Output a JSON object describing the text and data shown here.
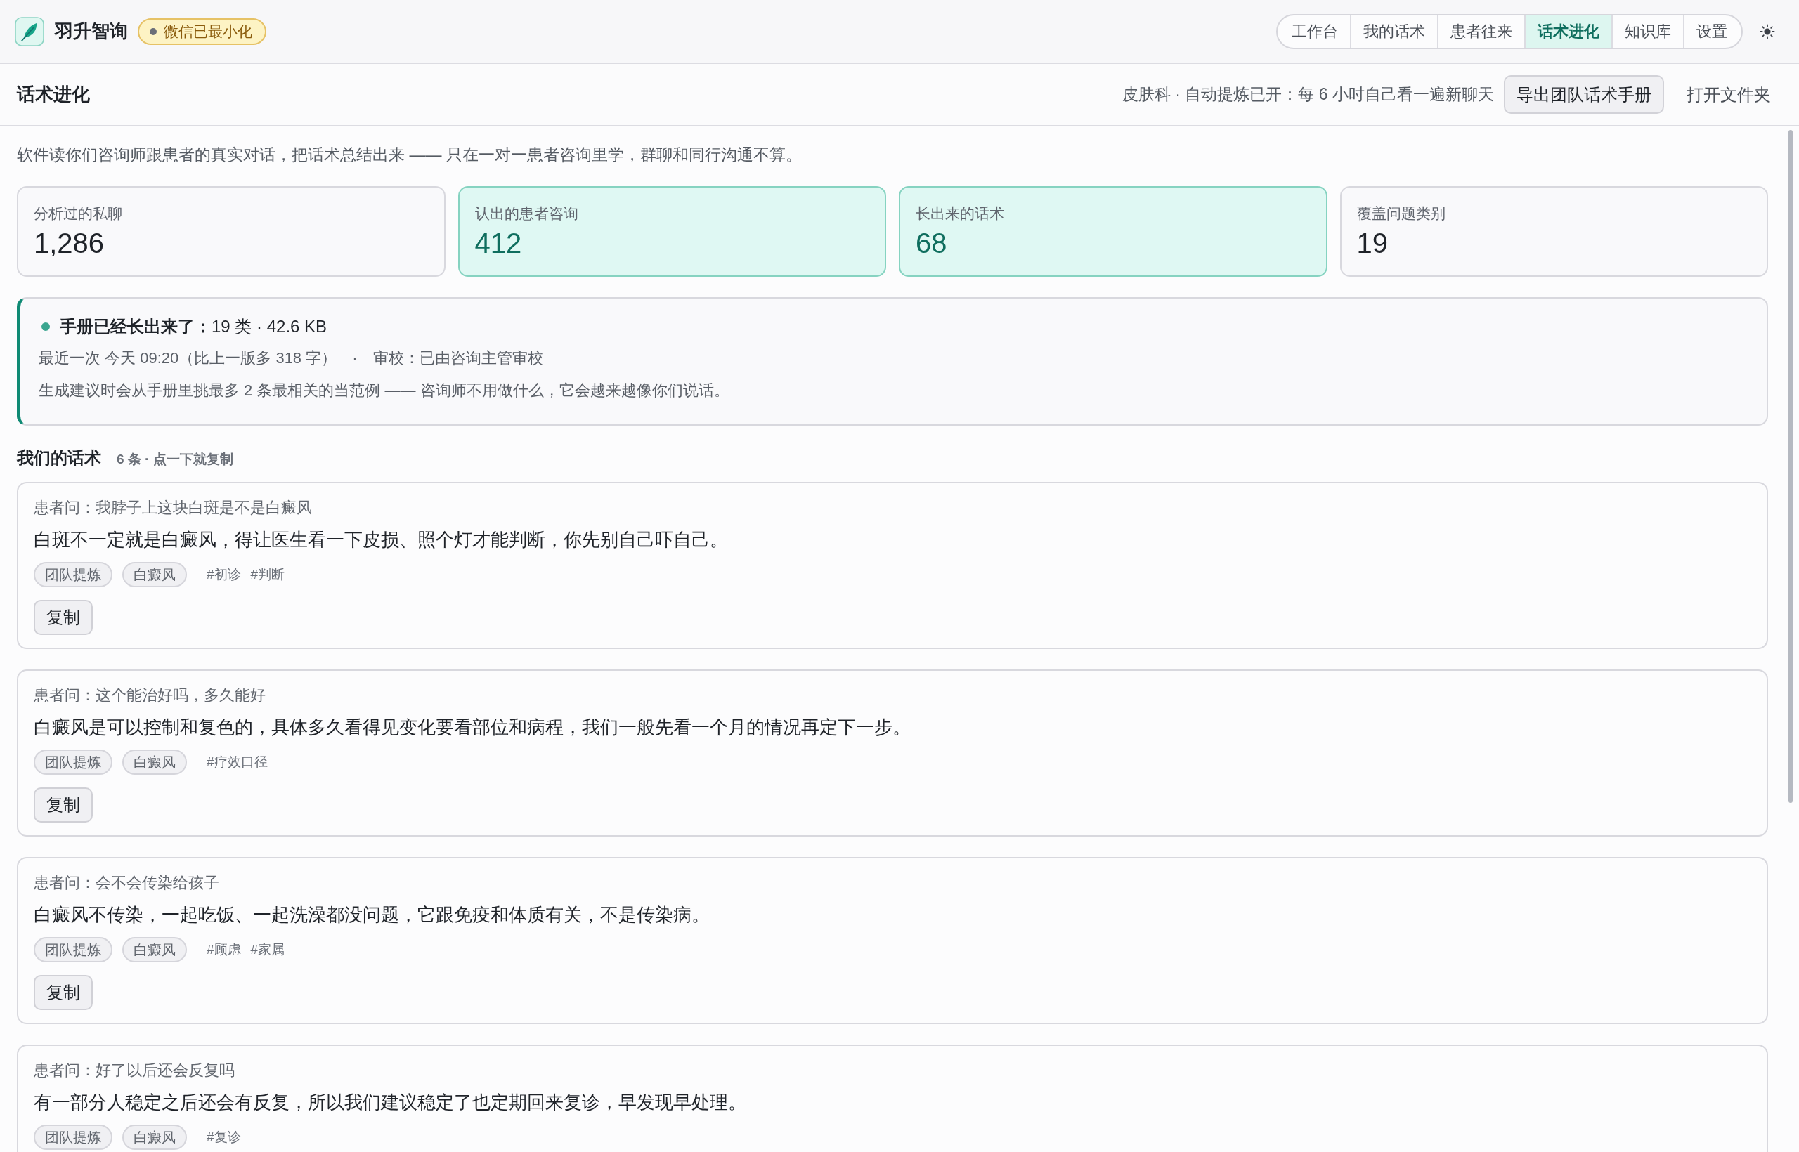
{
  "header": {
    "app_title": "羽升智询",
    "status_badge": "微信已最小化",
    "nav_tabs": [
      {
        "label": "工作台",
        "selected": false
      },
      {
        "label": "我的话术",
        "selected": false
      },
      {
        "label": "患者往来",
        "selected": false
      },
      {
        "label": "话术进化",
        "selected": true
      },
      {
        "label": "知识库",
        "selected": false
      },
      {
        "label": "设置",
        "selected": false
      }
    ]
  },
  "page_bar": {
    "title": "话术进化",
    "status": "皮肤科 · 自动提炼已开：每 6 小时自己看一遍新聊天",
    "buttons": [
      {
        "label": "导出团队话术手册",
        "kind": "outlined"
      },
      {
        "label": "打开文件夹",
        "kind": "plain"
      }
    ]
  },
  "intro": "软件读你们咨询师跟患者的真实对话，把话术总结出来 —— 只在一对一患者咨询里学，群聊和同行沟通不算。",
  "stats": [
    {
      "label": "分析过的私聊",
      "value": "1,286",
      "highlighted": false
    },
    {
      "label": "认出的患者咨询",
      "value": "412",
      "highlighted": true
    },
    {
      "label": "长出来的话术",
      "value": "68",
      "highlighted": true
    },
    {
      "label": "覆盖问题类别",
      "value": "19",
      "highlighted": false
    }
  ],
  "manual_panel": {
    "title": "**手册已经长出来了：**19 类 · 42.6 KB",
    "meta": [
      "最近一次 今天 09:20（比上一版多 318 字）",
      "·",
      "审校：已由咨询主管审校"
    ],
    "note": "生成建议时会从手册里挑最多 2 条最相关的当范例 —— 咨询师不用做什么，它会越来越像你们说话。"
  },
  "scripts": {
    "title": "我们的话术",
    "count": "6 条 · 点一下就复制",
    "items": [
      {
        "question": "患者问：我脖子上这块白斑是不是白癜风",
        "answer": "白斑不一定就是白癜风，得让医生看一下皮损、照个灯才能判断，你先别自己吓自己。",
        "tags": [
          "团队提炼",
          "白癜风"
        ],
        "hashtags": [
          "#初诊",
          "#判断"
        ],
        "copy_button": "复制"
      },
      {
        "question": "患者问：这个能治好吗，多久能好",
        "answer": "白癜风是可以控制和复色的，具体多久看得见变化要看部位和病程，我们一般先看一个月的情况再定下一步。",
        "tags": [
          "团队提炼",
          "白癜风"
        ],
        "hashtags": [
          "#疗效口径"
        ],
        "copy_button": "复制"
      },
      {
        "question": "患者问：会不会传染给孩子",
        "answer": "白癜风不传染，一起吃饭、一起洗澡都没问题，它跟免疫和体质有关，不是传染病。",
        "tags": [
          "团队提炼",
          "白癜风"
        ],
        "hashtags": [
          "#顾虑",
          "#家属"
        ],
        "copy_button": "复制"
      },
      {
        "question": "患者问：好了以后还会反复吗",
        "answer": "有一部分人稳定之后还会有反复，所以我们建议稳定了也定期回来复诊，早发现早处理。",
        "tags": [
          "团队提炼",
          "白癜风"
        ],
        "hashtags": [
          "#复诊"
        ]
      }
    ]
  }
}
